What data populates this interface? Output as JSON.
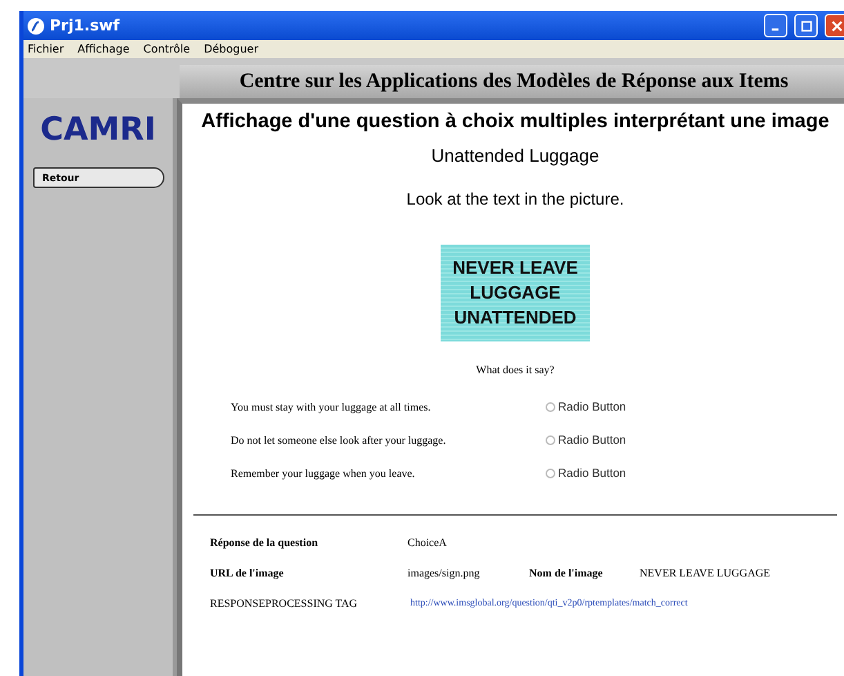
{
  "window": {
    "title": "Prj1.swf"
  },
  "menu": [
    "Fichier",
    "Affichage",
    "Contrôle",
    "Déboguer"
  ],
  "sidebar": {
    "logo": "CAMRI",
    "button": "Retour"
  },
  "header": "Centre sur les Applications des Modèles de Réponse aux Items",
  "heading": "Affichage d'une question à choix multiples interprétant une image",
  "item_title": "Unattended Luggage",
  "prompt": "Look at the text in the picture.",
  "sign": [
    "NEVER LEAVE",
    "LUGGAGE",
    "UNATTENDED"
  ],
  "question": "What does it say?",
  "choices": [
    {
      "text": "You must stay with your luggage at all times.",
      "radio": "Radio Button",
      "selected": false
    },
    {
      "text": "Do not let someone else look after your luggage.",
      "radio": "Radio Button",
      "selected": false
    },
    {
      "text": "Remember your luggage when you leave.",
      "radio": "Radio Button",
      "selected": false
    }
  ],
  "details": {
    "answer_label": "Réponse de la question",
    "answer": "ChoiceA",
    "url_label": "URL de l'image",
    "url": "images/sign.png",
    "name_label": "Nom de l'image",
    "name": "NEVER LEAVE LUGGAGE",
    "rp_label": "RESPONSEPROCESSING TAG",
    "rp_link": "http://www.imsglobal.org/question/qti_v2p0/rptemplates/match_correct"
  }
}
